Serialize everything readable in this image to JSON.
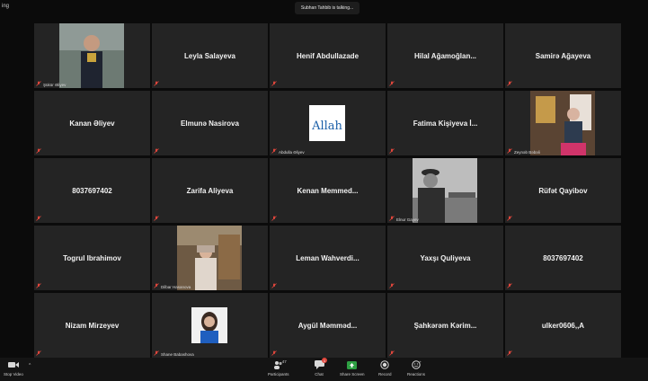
{
  "window": {
    "title_fragment": "ing"
  },
  "speaker_banner": "Subhan Tahbib is talking...",
  "tiles": [
    {
      "name": "",
      "caption": "Şükür Əliyev",
      "video": true
    },
    {
      "name": "Leyla Salayeva",
      "caption": "",
      "video": false
    },
    {
      "name": "Henif Abdullazade",
      "caption": "",
      "video": false
    },
    {
      "name": "Hilal Ağamoğlan...",
      "caption": "",
      "video": false
    },
    {
      "name": "Samirə Ağayeva",
      "caption": "",
      "video": false
    },
    {
      "name": "Kanan Əliyev",
      "caption": "",
      "video": false
    },
    {
      "name": "Elmunə Nasirova",
      "caption": "",
      "video": false
    },
    {
      "name": "",
      "caption": "Abdulla Əliyev",
      "video": true,
      "logo_text": "Allah"
    },
    {
      "name": "Fatima Kişiyeva İ...",
      "caption": "",
      "video": false
    },
    {
      "name": "",
      "caption": "Zeynəb Bəbəli",
      "video": true
    },
    {
      "name": "8037697402",
      "caption": "",
      "video": false
    },
    {
      "name": "Zarifa Aliyeva",
      "caption": "",
      "video": false
    },
    {
      "name": "Kenan Memmed...",
      "caption": "",
      "video": false
    },
    {
      "name": "",
      "caption": "Elnur Gayev",
      "video": true
    },
    {
      "name": "Rüfət Qayibov",
      "caption": "",
      "video": false
    },
    {
      "name": "Togrul Ibrahimov",
      "caption": "",
      "video": false
    },
    {
      "name": "",
      "caption": "Dilbar Hasanova",
      "video": true
    },
    {
      "name": "Leman Wahverdi...",
      "caption": "",
      "video": false
    },
    {
      "name": "Yaxşı Quliyeva",
      "caption": "",
      "video": false
    },
    {
      "name": "8037697402",
      "caption": "",
      "video": false
    },
    {
      "name": "Nizam Mirzeyev",
      "caption": "",
      "video": false
    },
    {
      "name": "",
      "caption": "Shane Babashova",
      "video": true
    },
    {
      "name": "Aygül Məmməd...",
      "caption": "",
      "video": false
    },
    {
      "name": "Şahkərəm Kərim...",
      "caption": "",
      "video": false
    },
    {
      "name": "ulker0606,,A",
      "caption": "",
      "video": false
    }
  ],
  "toolbar": {
    "stop_video": "Stop Video",
    "participants": "Participants",
    "participants_count": "47",
    "chat": "Chat",
    "chat_badge": "1",
    "share_screen": "Share Screen",
    "record": "Record",
    "reactions": "Reactions"
  },
  "colors": {
    "tile_bg": "#242424",
    "mute_red": "#e0463c",
    "share_green": "#2ea043"
  }
}
